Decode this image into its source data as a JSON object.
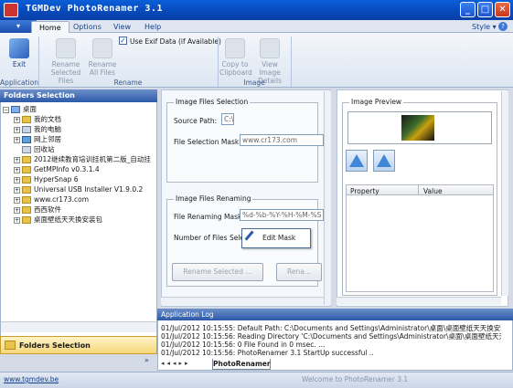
{
  "window": {
    "title": "TGMDev PhotoRenamer 3.1",
    "minimize": "_",
    "maximize": "□",
    "close": "✕"
  },
  "ribbon": {
    "app_menu": "▾",
    "tabs": [
      {
        "label": "Home"
      },
      {
        "label": "Options"
      },
      {
        "label": "View"
      },
      {
        "label": "Help"
      }
    ],
    "style_label": "Style ▾",
    "buttons": {
      "exit": "Exit",
      "rename_selected": "Rename Selected Files",
      "rename_all": "Rename All Files",
      "use_exif": "Use Exif Data (if Available)",
      "copy_clipboard": "Copy to Clipboard",
      "view_details": "View Image Details"
    },
    "groups": {
      "application": "Application",
      "rename": "Rename",
      "image": "Image"
    }
  },
  "folders": {
    "title": "Folders Selection",
    "items": [
      {
        "label": "桌面"
      },
      {
        "label": "我的文档"
      },
      {
        "label": "我的电脑"
      },
      {
        "label": "网上邻居"
      },
      {
        "label": "回收站"
      },
      {
        "label": "2012继续教育培训挂机第二版_自动挂"
      },
      {
        "label": "GetMPInfo v0.3.1.4"
      },
      {
        "label": "HyperSnap 6"
      },
      {
        "label": "Universal USB Installer V1.9.0.2"
      },
      {
        "label": "www.cr173.com"
      },
      {
        "label": "西西软件"
      },
      {
        "label": "桌面壁纸天天换安装包"
      }
    ],
    "footer": "Folders Selection"
  },
  "image_files": {
    "selection_title": "Image Files Selection",
    "source_path_label": "Source Path:",
    "source_path_value": "C:\\",
    "mask_label": "File Selection Mask:",
    "mask_value": "www.cr173.com",
    "renaming_title": "Image Files Renaming",
    "renaming_mask_label": "File Renaming Mask:",
    "renaming_mask_value": "%d-%b-%Y-%H-%M-%S",
    "number_label": "Number of Files Selected:",
    "edit_mask": "Edit Mask",
    "rename_selected": "Rename Selected ...",
    "rename_all": "Rena..."
  },
  "preview": {
    "title": "Image Preview",
    "columns": [
      "Property",
      "Value"
    ]
  },
  "log": {
    "title": "Application Log",
    "lines": [
      "01/Jul/2012 10:15:55: Default Path: C:\\Documents and Settings\\Administrator\\桌面\\桌面壁纸天天换安装包",
      "01/Jul/2012 10:15:56: Reading Directory 'C:\\Documents and Settings\\Administrator\\桌面\\桌面壁纸天天换安装",
      "01/Jul/2012 10:15:56: 0 File Found in 0 msec. ...",
      "01/Jul/2012 10:15:56: PhotoRenamer 3.1 StartUp successful .."
    ],
    "tab": "PhotoRenamer"
  },
  "status": {
    "link": "www.tgmdev.be",
    "message": "Welcome to PhotoRenamer 3.1"
  }
}
